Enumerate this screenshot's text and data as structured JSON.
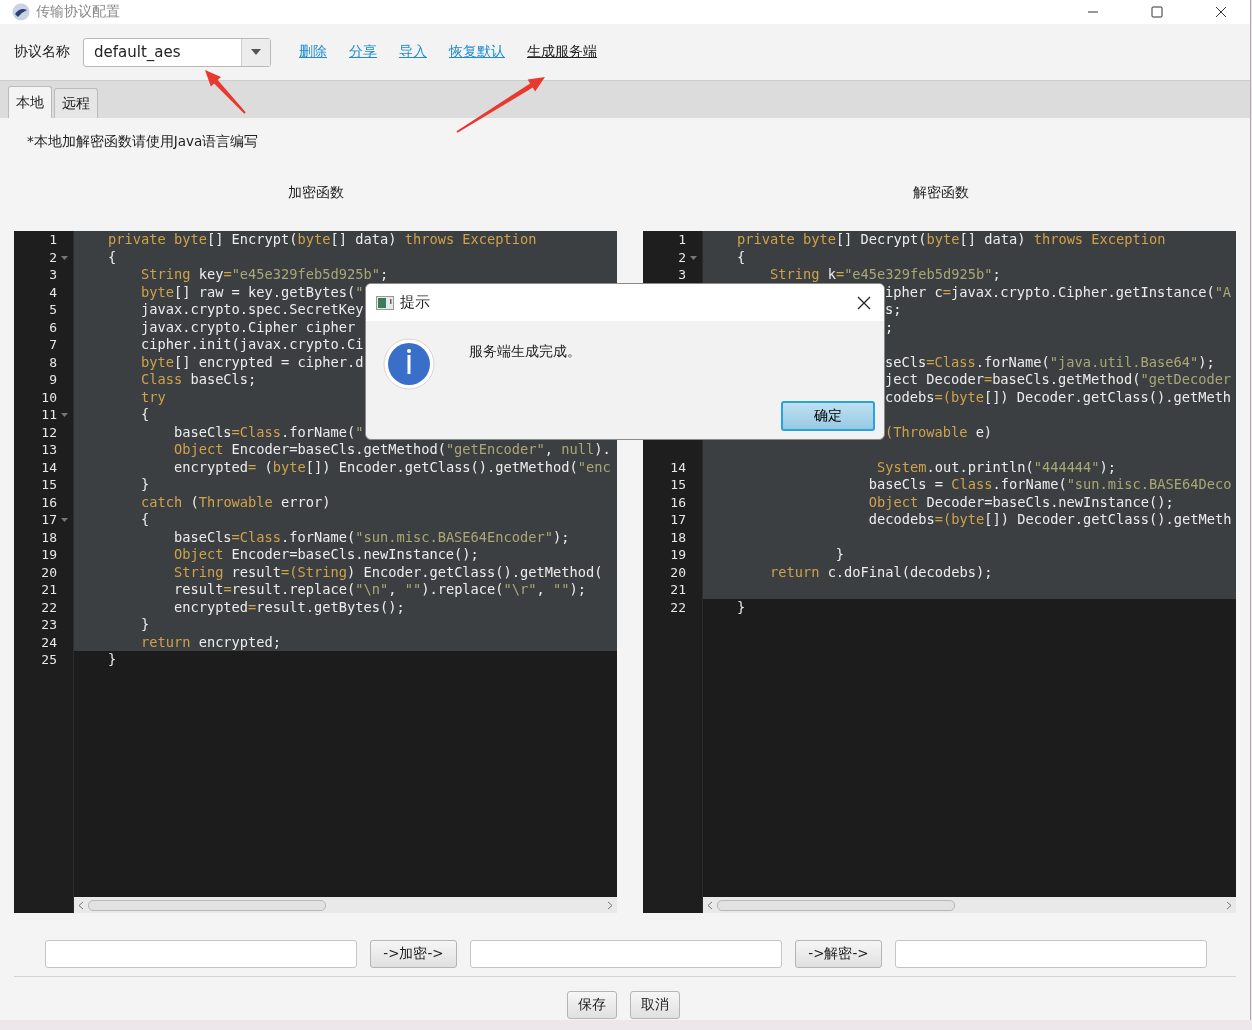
{
  "window": {
    "title": "传输协议配置"
  },
  "toolbar": {
    "label": "协议名称",
    "protocol": {
      "value": "default_aes"
    },
    "links": [
      {
        "label": "删除",
        "hovered": false
      },
      {
        "label": "分享",
        "hovered": false
      },
      {
        "label": "导入",
        "hovered": false
      },
      {
        "label": "恢复默认",
        "hovered": false
      },
      {
        "label": "生成服务端",
        "hovered": true
      }
    ]
  },
  "tabs": [
    {
      "label": "本地",
      "selected": true
    },
    {
      "label": "远程",
      "selected": false
    }
  ],
  "note": "*本地加解密函数请使用Java语言编写",
  "editors": [
    {
      "heading": "加密函数",
      "lines": [
        {
          "kind": "line",
          "n": "1",
          "tokens": [
            {
              "kind": "keyword",
              "text": "private byte"
            },
            {
              "kind": "plain",
              "text": "[] Encrypt("
            },
            {
              "kind": "keyword",
              "text": "byte"
            },
            {
              "kind": "plain",
              "text": "[] data) "
            },
            {
              "kind": "keyword",
              "text": "throws Exception"
            }
          ]
        },
        {
          "kind": "line",
          "n": "2",
          "foldable": true,
          "tokens": [
            {
              "kind": "plain",
              "text": "{"
            }
          ]
        },
        {
          "kind": "line",
          "n": "3",
          "tokens": [
            {
              "kind": "keyword",
              "text": "    String"
            },
            {
              "kind": "plain",
              "text": " key"
            },
            {
              "kind": "keyword",
              "text": "="
            },
            {
              "kind": "string",
              "text": "\"e45e329feb5d925b\""
            },
            {
              "kind": "plain",
              "text": ";"
            }
          ]
        },
        {
          "kind": "line",
          "n": "4",
          "tokens": [
            {
              "kind": "keyword",
              "text": "    byte"
            },
            {
              "kind": "plain",
              "text": "[] raw = key.getBytes("
            },
            {
              "kind": "string",
              "text": "\""
            }
          ]
        },
        {
          "kind": "line",
          "n": "5",
          "tokens": [
            {
              "kind": "plain",
              "text": "    javax.crypto.spec.SecretKey"
            }
          ]
        },
        {
          "kind": "line",
          "n": "6",
          "tokens": [
            {
              "kind": "plain",
              "text": "    javax.crypto.Cipher cipher"
            }
          ]
        },
        {
          "kind": "line",
          "n": "7",
          "tokens": [
            {
              "kind": "plain",
              "text": "    cipher.init(javax.crypto.Ci"
            }
          ]
        },
        {
          "kind": "line",
          "n": "8",
          "tokens": [
            {
              "kind": "keyword",
              "text": "    byte"
            },
            {
              "kind": "plain",
              "text": "[] encrypted = cipher.d"
            }
          ]
        },
        {
          "kind": "line",
          "n": "9",
          "tokens": [
            {
              "kind": "keyword",
              "text": "    Class"
            },
            {
              "kind": "plain",
              "text": " baseCls;"
            }
          ]
        },
        {
          "kind": "line",
          "n": "10",
          "tokens": [
            {
              "kind": "keyword",
              "text": "    try"
            }
          ]
        },
        {
          "kind": "line",
          "n": "11",
          "foldable": true,
          "tokens": [
            {
              "kind": "plain",
              "text": "    {"
            }
          ]
        },
        {
          "kind": "line",
          "n": "12",
          "tokens": [
            {
              "kind": "plain",
              "text": "        baseCls"
            },
            {
              "kind": "keyword",
              "text": "=Class"
            },
            {
              "kind": "plain",
              "text": ".forName("
            },
            {
              "kind": "string",
              "text": "\""
            }
          ]
        },
        {
          "kind": "line",
          "n": "13",
          "tokens": [
            {
              "kind": "keyword",
              "text": "        Object"
            },
            {
              "kind": "plain",
              "text": " Encoder=baseCls.getMethod("
            },
            {
              "kind": "string",
              "text": "\"getEncoder\""
            },
            {
              "kind": "plain",
              "text": ", "
            },
            {
              "kind": "string",
              "text": "null"
            },
            {
              "kind": "plain",
              "text": ")."
            }
          ]
        },
        {
          "kind": "line",
          "n": "14",
          "tokens": [
            {
              "kind": "plain",
              "text": "        encrypted"
            },
            {
              "kind": "keyword",
              "text": "="
            },
            {
              "kind": "plain",
              "text": " ("
            },
            {
              "kind": "keyword",
              "text": "byte"
            },
            {
              "kind": "plain",
              "text": "[]) Encoder.getClass().getMethod("
            },
            {
              "kind": "string",
              "text": "\"enc"
            }
          ]
        },
        {
          "kind": "line",
          "n": "15",
          "tokens": [
            {
              "kind": "plain",
              "text": "    }"
            }
          ]
        },
        {
          "kind": "line",
          "n": "16",
          "tokens": [
            {
              "kind": "keyword",
              "text": "    catch"
            },
            {
              "kind": "plain",
              "text": " ("
            },
            {
              "kind": "keyword",
              "text": "Throwable"
            },
            {
              "kind": "plain",
              "text": " error)"
            }
          ]
        },
        {
          "kind": "line",
          "n": "17",
          "foldable": true,
          "tokens": [
            {
              "kind": "plain",
              "text": "    {"
            }
          ]
        },
        {
          "kind": "line",
          "n": "18",
          "tokens": [
            {
              "kind": "plain",
              "text": "        baseCls"
            },
            {
              "kind": "keyword",
              "text": "=Class"
            },
            {
              "kind": "plain",
              "text": ".forName("
            },
            {
              "kind": "string",
              "text": "\"sun.misc.BASE64Encoder\""
            },
            {
              "kind": "plain",
              "text": ");"
            }
          ]
        },
        {
          "kind": "line",
          "n": "19",
          "tokens": [
            {
              "kind": "keyword",
              "text": "        Object"
            },
            {
              "kind": "plain",
              "text": " Encoder=baseCls.newInstance();"
            }
          ]
        },
        {
          "kind": "line",
          "n": "20",
          "tokens": [
            {
              "kind": "keyword",
              "text": "        String"
            },
            {
              "kind": "plain",
              "text": " result"
            },
            {
              "kind": "keyword",
              "text": "=(String"
            },
            {
              "kind": "plain",
              "text": ") Encoder.getClass().getMethod("
            }
          ]
        },
        {
          "kind": "line",
          "n": "21",
          "tokens": [
            {
              "kind": "plain",
              "text": "        result"
            },
            {
              "kind": "keyword",
              "text": "="
            },
            {
              "kind": "plain",
              "text": "result.replace("
            },
            {
              "kind": "string",
              "text": "\"\\n\""
            },
            {
              "kind": "plain",
              "text": ", "
            },
            {
              "kind": "string",
              "text": "\"\""
            },
            {
              "kind": "plain",
              "text": ").replace("
            },
            {
              "kind": "string",
              "text": "\"\\r\""
            },
            {
              "kind": "plain",
              "text": ", "
            },
            {
              "kind": "string",
              "text": "\"\""
            },
            {
              "kind": "plain",
              "text": ");"
            }
          ]
        },
        {
          "kind": "line",
          "n": "22",
          "tokens": [
            {
              "kind": "plain",
              "text": "        encrypted"
            },
            {
              "kind": "keyword",
              "text": "="
            },
            {
              "kind": "plain",
              "text": "result.getBytes();"
            }
          ]
        },
        {
          "kind": "line",
          "n": "23",
          "tokens": [
            {
              "kind": "plain",
              "text": "    }"
            }
          ]
        },
        {
          "kind": "line",
          "n": "24",
          "tokens": [
            {
              "kind": "keyword",
              "text": "    return"
            },
            {
              "kind": "plain",
              "text": " encrypted;"
            }
          ]
        },
        {
          "kind": "line",
          "n": "25",
          "current": true,
          "tokens": [
            {
              "kind": "plain",
              "text": "}"
            }
          ]
        }
      ]
    },
    {
      "heading": "解密函数",
      "lines": [
        {
          "kind": "line",
          "n": "1",
          "tokens": [
            {
              "kind": "keyword",
              "text": "private byte"
            },
            {
              "kind": "plain",
              "text": "[] Decrypt("
            },
            {
              "kind": "keyword",
              "text": "byte"
            },
            {
              "kind": "plain",
              "text": "[] data) "
            },
            {
              "kind": "keyword",
              "text": "throws Exception"
            }
          ]
        },
        {
          "kind": "line",
          "n": "2",
          "foldable": true,
          "tokens": [
            {
              "kind": "plain",
              "text": "{"
            }
          ]
        },
        {
          "kind": "line",
          "n": "3",
          "tokens": [
            {
              "kind": "keyword",
              "text": "    String"
            },
            {
              "kind": "plain",
              "text": " k"
            },
            {
              "kind": "keyword",
              "text": "="
            },
            {
              "kind": "string",
              "text": "\"e45e329feb5d925b\""
            },
            {
              "kind": "plain",
              "text": ";"
            }
          ]
        },
        {
          "kind": "fragment",
          "tokens": [
            {
              "kind": "plain",
              "text": "ipher c"
            },
            {
              "kind": "keyword",
              "text": "="
            },
            {
              "kind": "plain",
              "text": "javax.crypto.Cipher.getInstance("
            },
            {
              "kind": "string",
              "text": "\"A"
            }
          ]
        },
        {
          "kind": "fragment",
          "tokens": [
            {
              "kind": "plain",
              "text": "s;"
            }
          ]
        },
        {
          "kind": "fragment",
          "tokens": [
            {
              "kind": "plain",
              "text": ";"
            }
          ]
        },
        {
          "kind": "blank"
        },
        {
          "kind": "fragment",
          "tokens": [
            {
              "kind": "plain",
              "text": "seCls"
            },
            {
              "kind": "keyword",
              "text": "=Class"
            },
            {
              "kind": "plain",
              "text": ".forName("
            },
            {
              "kind": "string",
              "text": "\"java.util.Base64\""
            },
            {
              "kind": "plain",
              "text": ");"
            }
          ]
        },
        {
          "kind": "fragment",
          "tokens": [
            {
              "kind": "plain",
              "text": "ject Decoder"
            },
            {
              "kind": "keyword",
              "text": "="
            },
            {
              "kind": "plain",
              "text": "baseCls.getMethod("
            },
            {
              "kind": "string",
              "text": "\"getDecoder"
            }
          ]
        },
        {
          "kind": "fragment",
          "tokens": [
            {
              "kind": "plain",
              "text": "codebs"
            },
            {
              "kind": "keyword",
              "text": "=(byte"
            },
            {
              "kind": "plain",
              "text": "[]) Decoder.getClass().getMeth"
            }
          ]
        },
        {
          "kind": "blank"
        },
        {
          "kind": "fragment",
          "tokens": [
            {
              "kind": "keyword",
              "text": "(Throwable"
            },
            {
              "kind": "plain",
              "text": " e)"
            }
          ]
        },
        {
          "kind": "blank"
        },
        {
          "kind": "line",
          "n": "14",
          "tokens": [
            {
              "kind": "keyword",
              "text": "                 System"
            },
            {
              "kind": "plain",
              "text": ".out.println("
            },
            {
              "kind": "string",
              "text": "\"444444\""
            },
            {
              "kind": "plain",
              "text": ");"
            }
          ]
        },
        {
          "kind": "line",
          "n": "15",
          "tokens": [
            {
              "kind": "plain",
              "text": "                baseCls = "
            },
            {
              "kind": "keyword",
              "text": "Class"
            },
            {
              "kind": "plain",
              "text": ".forName("
            },
            {
              "kind": "string",
              "text": "\"sun.misc.BASE64Deco"
            }
          ]
        },
        {
          "kind": "line",
          "n": "16",
          "tokens": [
            {
              "kind": "keyword",
              "text": "                Object"
            },
            {
              "kind": "plain",
              "text": " Decoder=baseCls.newInstance();"
            }
          ]
        },
        {
          "kind": "line",
          "n": "17",
          "tokens": [
            {
              "kind": "plain",
              "text": "                decodebs"
            },
            {
              "kind": "keyword",
              "text": "=(byte"
            },
            {
              "kind": "plain",
              "text": "[]) Decoder.getClass().getMeth"
            }
          ]
        },
        {
          "kind": "line",
          "n": "18"
        },
        {
          "kind": "line",
          "n": "19",
          "tokens": [
            {
              "kind": "plain",
              "text": "            }"
            }
          ]
        },
        {
          "kind": "line",
          "n": "20",
          "tokens": [
            {
              "kind": "keyword",
              "text": "    return"
            },
            {
              "kind": "plain",
              "text": " c.doFinal(decodebs);"
            }
          ]
        },
        {
          "kind": "line",
          "n": "21"
        },
        {
          "kind": "line",
          "n": "22",
          "current": true,
          "tokens": [
            {
              "kind": "plain",
              "text": "}"
            }
          ]
        }
      ]
    }
  ],
  "converter": {
    "buttons": [
      "->加密->",
      "->解密->"
    ]
  },
  "footer_buttons": [
    "保存",
    "取消"
  ],
  "dialog": {
    "title": "提示",
    "message": "服务端生成完成。",
    "button": "确定"
  },
  "annotations": [
    {
      "kind": "arrow"
    },
    {
      "kind": "arrow"
    }
  ]
}
